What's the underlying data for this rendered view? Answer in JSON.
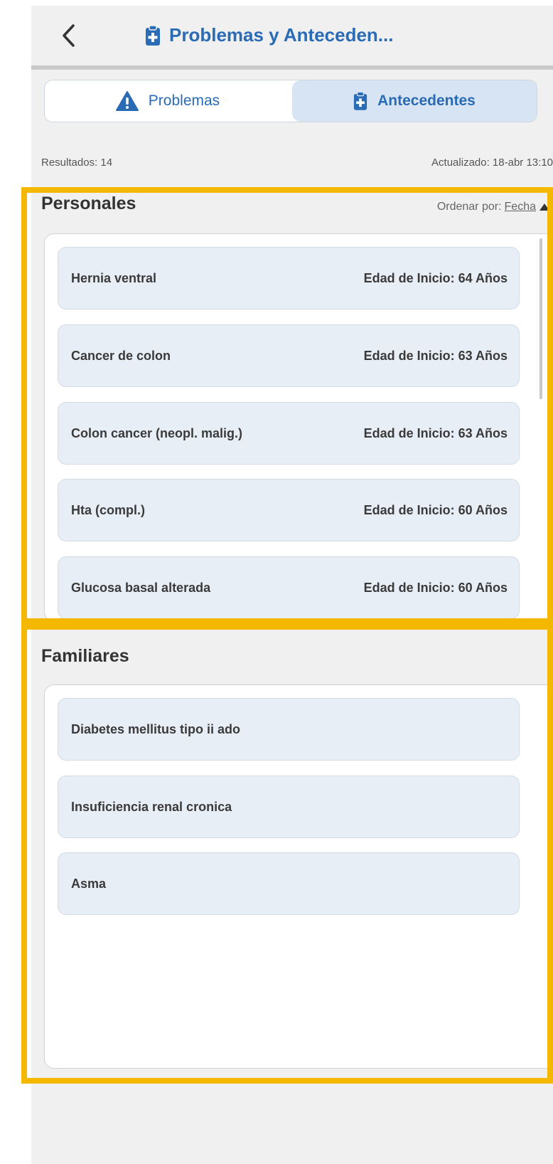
{
  "header": {
    "back_icon": "chevron-left-icon",
    "title_icon": "clipboard-medical-icon",
    "title": "Problemas y Anteceden..."
  },
  "tabs": [
    {
      "label": "Problemas",
      "icon": "warning-icon",
      "selected": false
    },
    {
      "label": "Antecedentes",
      "icon": "clipboard-medical-icon",
      "selected": true
    }
  ],
  "meta": {
    "results": "Resultados: 14",
    "updated": "Actualizado: 18-abr 13:10"
  },
  "personales": {
    "title": "Personales",
    "sort_prefix": "Ordenar por:",
    "sort_field": "Fecha",
    "sort_direction_icon": "triangle-up-icon",
    "items": [
      {
        "name": "Hernia ventral",
        "age": "Edad de Inicio: 64 Años"
      },
      {
        "name": "Cancer de colon",
        "age": "Edad de Inicio: 63 Años"
      },
      {
        "name": "Colon cancer (neopl. malig.)",
        "age": "Edad de Inicio: 63 Años"
      },
      {
        "name": "Hta (compl.)",
        "age": "Edad de Inicio: 60 Años"
      },
      {
        "name": "Glucosa basal alterada",
        "age": "Edad de Inicio: 60 Años"
      }
    ]
  },
  "familiares": {
    "title": "Familiares",
    "items": [
      {
        "name": "Diabetes mellitus tipo ii ado"
      },
      {
        "name": "Insuficiencia renal cronica"
      },
      {
        "name": "Asma"
      }
    ]
  },
  "colors": {
    "accent": "#2a6bb5",
    "selected_tab_bg": "#d6e4f3",
    "card_bg": "#e8eef6",
    "highlight": "#f5b800"
  }
}
